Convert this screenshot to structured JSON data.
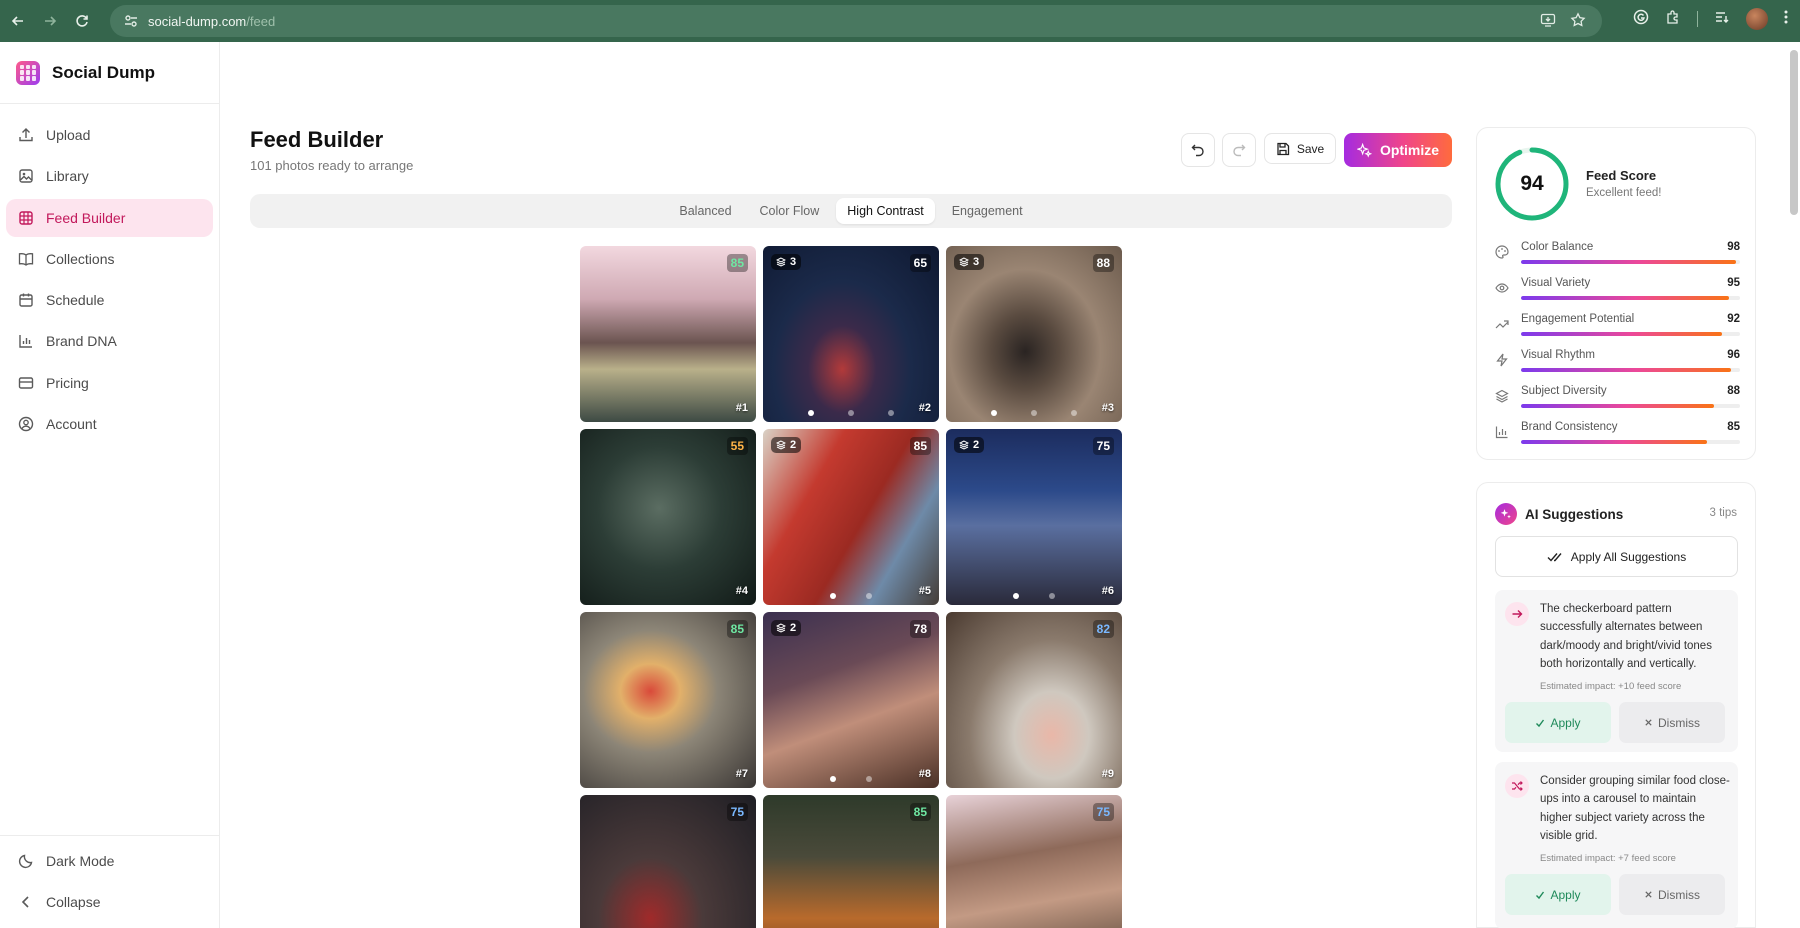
{
  "browser": {
    "url_host": "social-dump.com",
    "url_path": "/feed"
  },
  "app": {
    "name": "Social Dump"
  },
  "sidebar": {
    "items": [
      {
        "label": "Upload",
        "icon": "upload-icon"
      },
      {
        "label": "Library",
        "icon": "image-icon"
      },
      {
        "label": "Feed Builder",
        "icon": "grid-icon",
        "active": true
      },
      {
        "label": "Collections",
        "icon": "book-icon"
      },
      {
        "label": "Schedule",
        "icon": "calendar-icon"
      },
      {
        "label": "Brand DNA",
        "icon": "bar-chart-icon"
      },
      {
        "label": "Pricing",
        "icon": "credit-card-icon"
      },
      {
        "label": "Account",
        "icon": "user-circle-icon"
      }
    ],
    "bottom": {
      "dark_mode": "Dark Mode",
      "collapse": "Collapse"
    }
  },
  "header": {
    "title": "Feed Builder",
    "subtitle": "101 photos ready to arrange",
    "save_label": "Save",
    "optimize_label": "Optimize"
  },
  "tabs": [
    {
      "label": "Balanced"
    },
    {
      "label": "Color Flow"
    },
    {
      "label": "High Contrast",
      "active": true
    },
    {
      "label": "Engagement"
    }
  ],
  "tiles": [
    {
      "num": "#1",
      "score": "85",
      "score_color": "green",
      "layers": null,
      "dots": 0
    },
    {
      "num": "#2",
      "score": "65",
      "score_color": "white",
      "layers": "3",
      "dots": 3
    },
    {
      "num": "#3",
      "score": "88",
      "score_color": "white",
      "layers": "3",
      "dots": 3
    },
    {
      "num": "#4",
      "score": "55",
      "score_color": "orange",
      "layers": null,
      "dots": 0
    },
    {
      "num": "#5",
      "score": "85",
      "score_color": "white",
      "layers": "2",
      "dots": 2
    },
    {
      "num": "#6",
      "score": "75",
      "score_color": "white",
      "layers": "2",
      "dots": 2
    },
    {
      "num": "#7",
      "score": "85",
      "score_color": "green",
      "layers": null,
      "dots": 0
    },
    {
      "num": "#8",
      "score": "78",
      "score_color": "white",
      "layers": "2",
      "dots": 2
    },
    {
      "num": "#9",
      "score": "82",
      "score_color": "blue",
      "layers": null,
      "dots": 0
    },
    {
      "num": "",
      "score": "75",
      "score_color": "blue",
      "layers": null,
      "dots": 0
    },
    {
      "num": "",
      "score": "85",
      "score_color": "green",
      "layers": null,
      "dots": 0
    },
    {
      "num": "",
      "score": "75",
      "score_color": "blue",
      "layers": null,
      "dots": 0
    }
  ],
  "feed_score": {
    "value": "94",
    "value_num": 94,
    "title": "Feed Score",
    "subtitle": "Excellent feed!",
    "metrics": [
      {
        "label": "Color Balance",
        "value": "98",
        "icon": "palette-icon"
      },
      {
        "label": "Visual Variety",
        "value": "95",
        "icon": "eye-icon"
      },
      {
        "label": "Engagement Potential",
        "value": "92",
        "icon": "trending-up-icon"
      },
      {
        "label": "Visual Rhythm",
        "value": "96",
        "icon": "zap-icon"
      },
      {
        "label": "Subject Diversity",
        "value": "88",
        "icon": "layers-icon"
      },
      {
        "label": "Brand Consistency",
        "value": "85",
        "icon": "bar-chart-icon"
      }
    ]
  },
  "ai": {
    "title": "AI Suggestions",
    "tips": "3 tips",
    "apply_all": "Apply All Suggestions",
    "suggestions": [
      {
        "icon": "arrow-right-icon",
        "text": "The checkerboard pattern successfully alternates between dark/moody and bright/vivid tones both horizontally and vertically.",
        "impact": "Estimated impact: +10 feed score",
        "apply": "Apply",
        "dismiss": "Dismiss"
      },
      {
        "icon": "shuffle-icon",
        "text": "Consider grouping similar food close-ups into a carousel to maintain higher subject variety across the visible grid.",
        "impact": "Estimated impact: +7 feed score",
        "apply": "Apply",
        "dismiss": "Dismiss"
      }
    ]
  },
  "colors": {
    "accent": "#c2185b",
    "active_bg": "#fde4ee",
    "score_ring": "#1fb57a",
    "browser_bar": "#35654c"
  }
}
